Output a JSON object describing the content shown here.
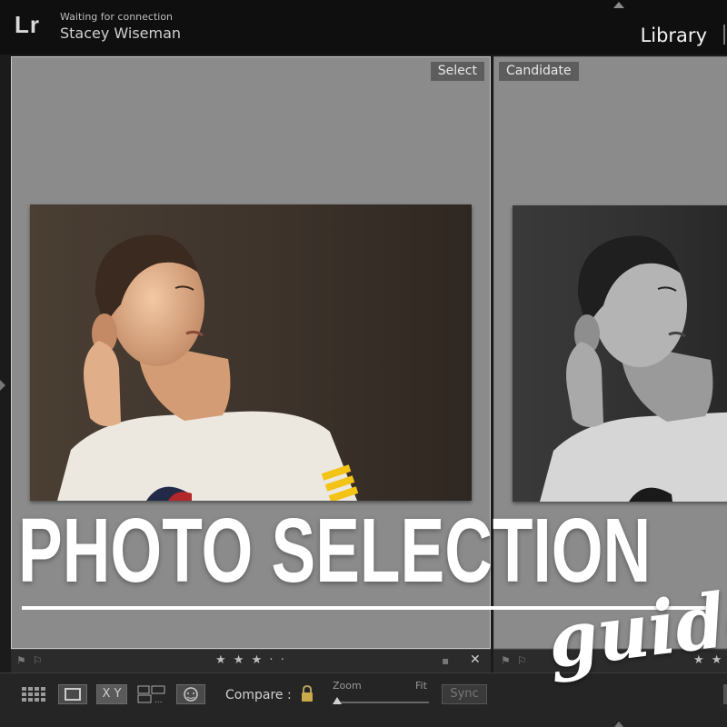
{
  "topbar": {
    "logo": "Lr",
    "status": "Waiting for connection",
    "user": "Stacey Wiseman",
    "module": "Library"
  },
  "panes": {
    "select_label": "Select",
    "candidate_label": "Candidate"
  },
  "strip": {
    "stars": "★ ★ ★ · ·",
    "close": "✕",
    "stars_partial": "★ ★"
  },
  "toolbar": {
    "compare_label": "Compare :",
    "xy_label": "X Y",
    "zoom_label": "Zoom",
    "fit_label": "Fit",
    "sync_label": "Sync"
  },
  "overlay": {
    "headline": "PHOTO SELECTION",
    "script": "guide"
  },
  "colors": {
    "pane_bg": "#8b8b8b",
    "toolbar_bg": "#252525",
    "headline": "#ffffff"
  }
}
